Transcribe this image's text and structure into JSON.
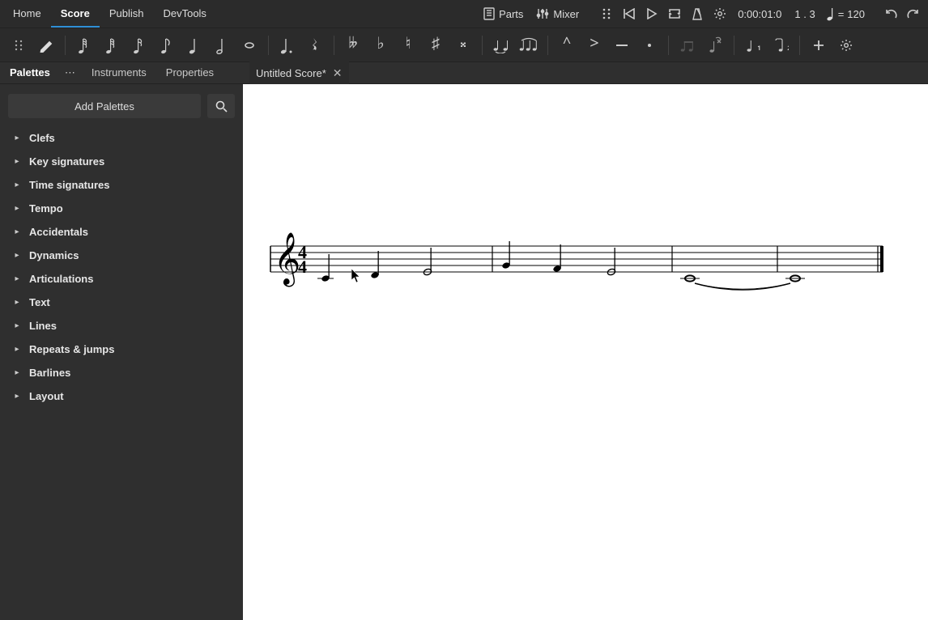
{
  "nav": {
    "tabs": [
      "Home",
      "Score",
      "Publish",
      "DevTools"
    ],
    "active": 1,
    "parts_label": "Parts",
    "mixer_label": "Mixer",
    "playback_time": "0:00:01:0",
    "bar_beat": "1 . 3",
    "tempo_prefix": "= ",
    "tempo_value": "120"
  },
  "toolbar": {
    "note_durations": [
      "64th",
      "32nd",
      "16th",
      "8th",
      "quarter",
      "half",
      "whole"
    ],
    "accidentals": [
      "double-flat",
      "flat",
      "natural",
      "sharp",
      "double-sharp"
    ],
    "articulations": [
      "marcato",
      "accent",
      "tenuto",
      "staccato"
    ],
    "voices": [
      "1",
      "2"
    ]
  },
  "panels": {
    "palettes": "Palettes",
    "instruments": "Instruments",
    "properties": "Properties",
    "add_palettes_label": "Add Palettes"
  },
  "document": {
    "title": "Untitled Score*"
  },
  "palette_list": [
    {
      "label": "Clefs"
    },
    {
      "label": "Key signatures"
    },
    {
      "label": "Time signatures"
    },
    {
      "label": "Tempo"
    },
    {
      "label": "Accidentals"
    },
    {
      "label": "Dynamics"
    },
    {
      "label": "Articulations"
    },
    {
      "label": "Text"
    },
    {
      "label": "Lines"
    },
    {
      "label": "Repeats & jumps"
    },
    {
      "label": "Barlines"
    },
    {
      "label": "Layout"
    }
  ],
  "score": {
    "clef": "treble",
    "time_signature": "4/4",
    "measures": [
      {
        "notes": [
          {
            "pitch": "C4",
            "dur": "quarter"
          },
          {
            "pitch": "D4",
            "dur": "quarter"
          },
          {
            "pitch": "E4",
            "dur": "half"
          }
        ]
      },
      {
        "notes": [
          {
            "pitch": "G4",
            "dur": "quarter"
          },
          {
            "pitch": "F4",
            "dur": "quarter"
          },
          {
            "pitch": "E4",
            "dur": "half"
          }
        ]
      },
      {
        "notes": [
          {
            "pitch": "C4",
            "dur": "whole",
            "tie_start": true
          }
        ]
      },
      {
        "notes": [
          {
            "pitch": "C4",
            "dur": "whole",
            "tie_end": true
          }
        ]
      }
    ]
  }
}
